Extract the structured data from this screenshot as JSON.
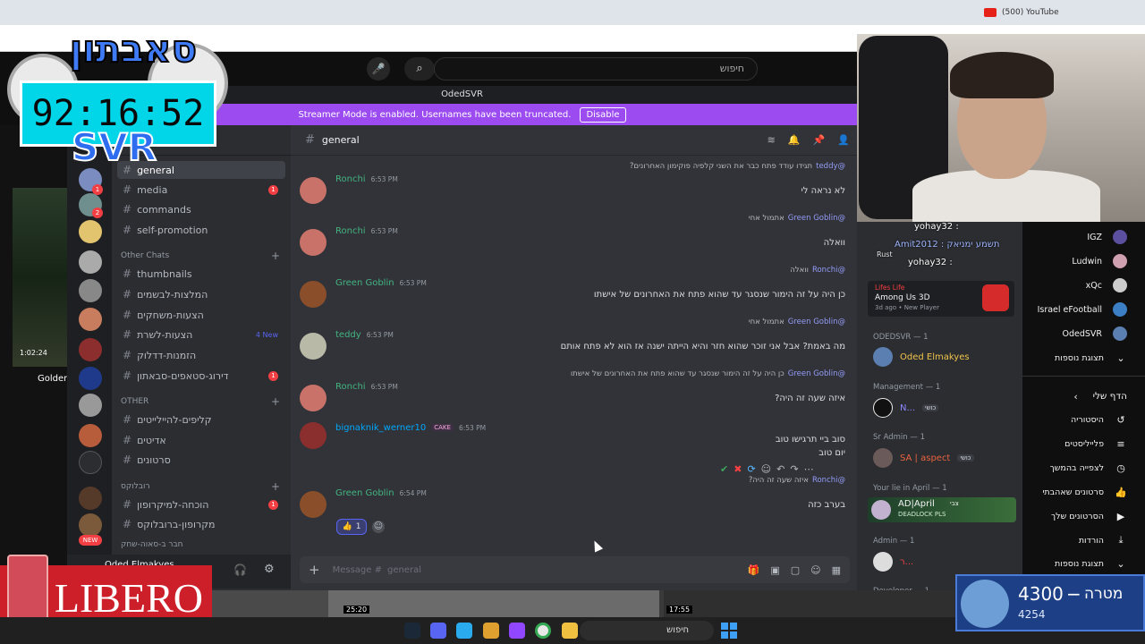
{
  "browser": {
    "tab_title": "(500) YouTube"
  },
  "youtube": {
    "search_placeholder": "חיפוש"
  },
  "discord": {
    "window_title": "OdedSVR",
    "streamer_banner": "Streamer Mode is enabled. Usernames have been truncated.",
    "disable_label": "Disable",
    "channel_header": "general",
    "channels": [
      {
        "name": "general",
        "active": true
      },
      {
        "name": "media",
        "badge": "1"
      },
      {
        "name": "commands"
      },
      {
        "name": "self-promotion"
      }
    ],
    "cat_other_chats": "Other Chats",
    "other_chats": [
      {
        "name": "thumbnails"
      },
      {
        "name": "המלצות-לבשמים"
      },
      {
        "name": "הצעות-משחקים"
      },
      {
        "name": "הצעות-לשרת",
        "new": "4 New"
      },
      {
        "name": "הזמנות-דדלוק"
      },
      {
        "name": "דירוג-סטאפים-סבאתון",
        "badge": "1"
      }
    ],
    "cat_other": "OTHER",
    "other": [
      {
        "name": "קליפים-להיילייטים"
      },
      {
        "name": "אדיטים"
      },
      {
        "name": "סרטונים"
      }
    ],
    "cat_roblox": "רובלוקס",
    "roblox": [
      {
        "name": "הוכחה-למיקרופון",
        "badge": "1"
      },
      {
        "name": "מקרופון-ברובלוקס"
      }
    ],
    "cat_more": "חבר ב-סאוה-שחק",
    "user_name": "Oded Elmakyes",
    "composer_placeholder": "Message #",
    "composer_channel": "general",
    "messages": [
      {
        "reply_user": "@teddy",
        "reply_text": "תגידו עודד פתח כבר את השני קלפיה פוקימון האחרונים?",
        "author": "Ronchi",
        "time": "6:53 PM",
        "text": "לא נראה לי",
        "color": "#43b581",
        "avatar": "#c9726a"
      },
      {
        "reply_user": "@Green Goblin",
        "reply_text": "אתמול אחי",
        "author": "Ronchi",
        "time": "6:53 PM",
        "text": "וואלה",
        "color": "#43b581",
        "avatar": "#c9726a"
      },
      {
        "reply_user": "@Ronchi",
        "reply_text": "וואלה",
        "author": "Green Goblin",
        "time": "6:53 PM",
        "text": "כן היה על זה הימור שנסגר עד שהוא פתח את האחרונים של אישתו",
        "color": "#43b581",
        "avatar": "#8a4f2a"
      },
      {
        "reply_user": "@Green Goblin",
        "reply_text": "אתמול אחי",
        "author": "teddy",
        "time": "6:53 PM",
        "text": "מה באמת? אבל אני זוכר שהוא חזר והיא הייתה ישנה אז הוא לא פתח אותם",
        "color": "#43b581",
        "avatar": "#b9b9a8"
      },
      {
        "reply_user": "@Green Goblin",
        "reply_text": "כן היה על זה הימור שנסגר עד שהוא פתח את האחרונים של אישתו",
        "author": "Ronchi",
        "time": "6:53 PM",
        "text": "איזה שעה זה היה?",
        "color": "#43b581",
        "avatar": "#c9726a"
      },
      {
        "reply_user": "",
        "reply_text": "",
        "author": "bignaknik_werner10",
        "time": "6:53 PM",
        "text": "סוב ביי תרגישו טוב",
        "text2": "יום טוב",
        "color": "#00a8fc",
        "avatar": "#8b2e2e",
        "tag": "CAKE"
      },
      {
        "reply_user": "@Ronchi",
        "reply_text": "איזה שעה זה היה?",
        "author": "Green Goblin",
        "time": "6:54 PM",
        "text": "בערב כזה",
        "color": "#43b581",
        "avatar": "#8a4f2a"
      }
    ],
    "reaction_count": "1",
    "members": {
      "overlay_line1": "yohay32 :",
      "overlay_line2": "Amit2012 : תשמע ימניאק",
      "overlay_line3": "yohay32 :",
      "overlay_rust": "Rust",
      "game_top": "Lifes Life",
      "game_title": "Among Us 3D",
      "game_meta": "3d ago  •  New Player",
      "odedsvr_head": "ODEDSVR — 1",
      "oded": "Oded Elmakyes",
      "mgmt_head": "Management — 1",
      "mgmt_name": "N...",
      "mgmt_tag": "כושי",
      "sradmin_head": "Sr Admin — 1",
      "sradmin_name": "SA | aspect",
      "sradmin_tag": "כושי",
      "april_head": "Your lie in April — 1",
      "april_name": "AD|April",
      "april_tag": "צבי",
      "april_sub": "DEADLOCK PLS",
      "admin_head": "Admin — 1",
      "admin_name": "ר...",
      "dev_head": "Developer — 1"
    }
  },
  "yt_sidebar": {
    "subs": [
      {
        "name": "IGZ",
        "color": "#5b4fa0"
      },
      {
        "name": "Ludwin",
        "color": "#d0a0b0"
      },
      {
        "name": "xQc",
        "color": "#cccccc"
      },
      {
        "name": "Israel eFootball",
        "color": "#3d7fc4"
      },
      {
        "name": "OdedSVR",
        "color": "#5b7fb0"
      }
    ],
    "show_more_1": "תצוגת נוספות",
    "you": "הדף שלי",
    "items": [
      {
        "label": "היסטוריה",
        "icon": "history-icon",
        "glyph": "↺"
      },
      {
        "label": "פלייליסטים",
        "icon": "playlists-icon",
        "glyph": "≡"
      },
      {
        "label": "לצפייה בהמשך",
        "icon": "watch-later-icon",
        "glyph": "◷"
      },
      {
        "label": "סרטונים שאהבתי",
        "icon": "liked-icon",
        "glyph": "👍"
      },
      {
        "label": "הסרטונים שלך",
        "icon": "your-videos-icon",
        "glyph": "▶"
      },
      {
        "label": "הורדות",
        "icon": "downloads-icon",
        "glyph": "⤓"
      }
    ],
    "show_more_2": "תצוגת נוספות"
  },
  "overlay": {
    "timer": "92:16:52",
    "svr": "SVR",
    "logo": "סאבתון",
    "left_time": "1:02:24",
    "golden": "Golden",
    "libero": "LIBERO",
    "new": "NEW"
  },
  "bottom": {
    "time1": "25:20",
    "time2": "17:55"
  },
  "taskbar": {
    "search": "חיפוש"
  },
  "goal": {
    "value": "4300",
    "label": "מטרה",
    "current": "4254"
  }
}
